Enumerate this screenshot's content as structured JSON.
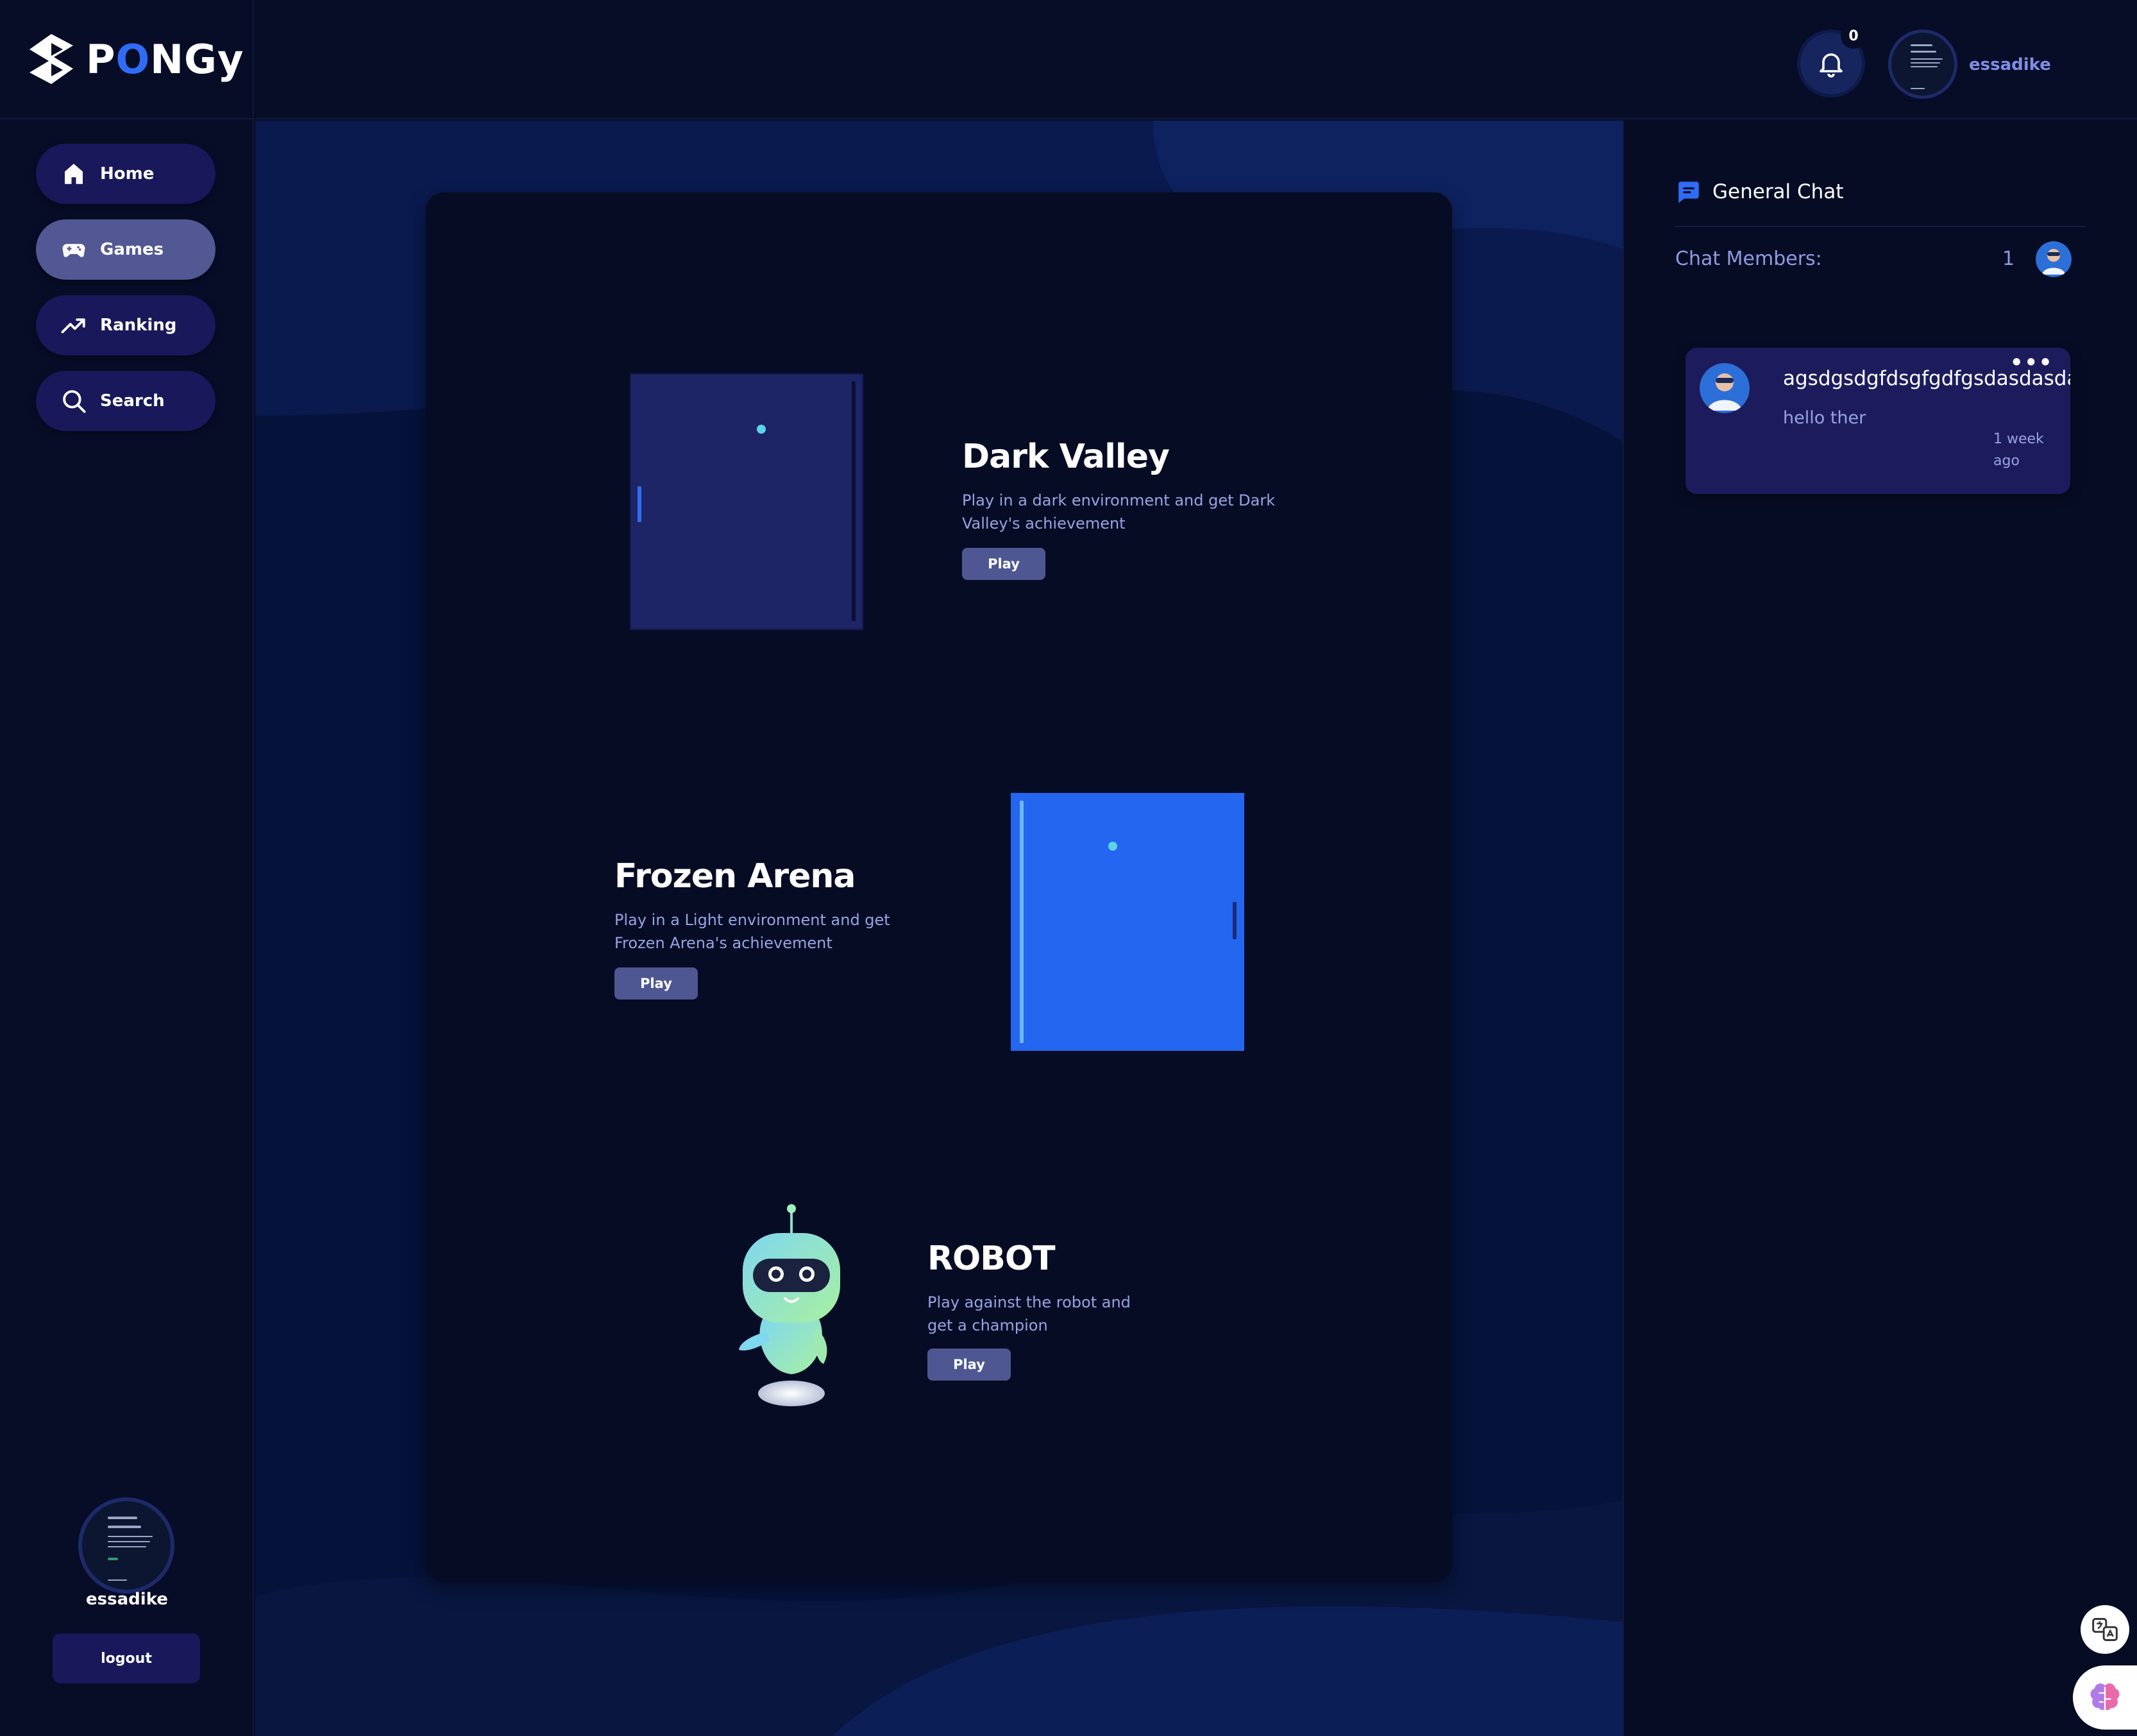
{
  "brand": {
    "logo_icon": "pongy-logo-icon",
    "name_part1": "P",
    "name_highlight": "O",
    "name_part2": "NGy",
    "accent_color": "#2f6cf5"
  },
  "sidebar": {
    "items": [
      {
        "label": "Home",
        "icon": "home-icon"
      },
      {
        "label": "Games",
        "icon": "gamepad-icon",
        "active": true
      },
      {
        "label": "Ranking",
        "icon": "trending-up-icon"
      },
      {
        "label": "Search",
        "icon": "search-icon"
      }
    ],
    "username": "essadike",
    "logout_label": "logout"
  },
  "header": {
    "notification_count": "0",
    "username": "essadike"
  },
  "games": [
    {
      "title": "Dark Valley",
      "description": "Play in a dark environment and get Dark Valley's achievement",
      "play_label": "Play"
    },
    {
      "title": "Frozen Arena",
      "description": "Play in a Light environment and get Frozen Arena's achievement",
      "play_label": "Play"
    },
    {
      "title": "ROBOT",
      "description": "Play against the robot and get a champion",
      "play_label": "Play"
    }
  ],
  "chat": {
    "title": "General Chat",
    "members_label": "Chat Members:",
    "members_count": "1",
    "messages": [
      {
        "name": "agsdgsdgfdsgfgdfgsdasdasdadasdasd",
        "text": "hello ther",
        "time": "1 week ago"
      }
    ]
  },
  "colors": {
    "background": "#060c24",
    "nav_button": "#18185a",
    "nav_active": "#525893",
    "play_button": "#4e5792",
    "dark_valley_table": "#1e2566",
    "frozen_arena_table": "#2466f0",
    "ball": "#5cd3e6"
  }
}
